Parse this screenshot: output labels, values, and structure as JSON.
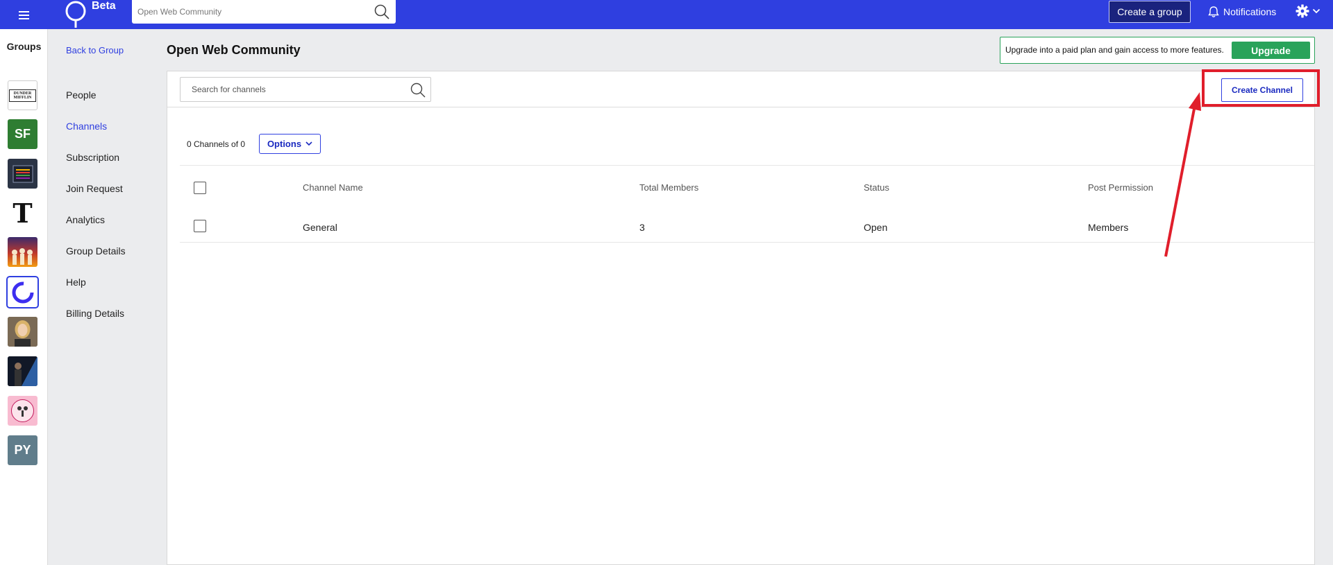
{
  "topbar": {
    "logo_badge": "Beta",
    "search_placeholder": "Open Web Community",
    "create_group_label": "Create a group",
    "notifications_label": "Notifications",
    "brand_color": "#2f3fe0"
  },
  "rail": {
    "title": "Groups",
    "groups": [
      {
        "label": "DUNDER MIFFLIN",
        "kind": "logo"
      },
      {
        "label": "SF",
        "color": "#2e7d32"
      },
      {
        "label": "",
        "kind": "book"
      },
      {
        "label": "T",
        "kind": "nyt"
      },
      {
        "label": "",
        "kind": "concert"
      },
      {
        "label": "",
        "kind": "ring",
        "selected": true
      },
      {
        "label": "",
        "kind": "person"
      },
      {
        "label": "",
        "kind": "photo"
      },
      {
        "label": "",
        "kind": "pink-badge"
      },
      {
        "label": "PY",
        "color": "#607d8b"
      }
    ]
  },
  "subnav": {
    "back": "Back to Group",
    "items": [
      "People",
      "Channels",
      "Subscription",
      "Join Request",
      "Analytics",
      "Group Details",
      "Help",
      "Billing Details"
    ],
    "active": "Channels"
  },
  "main": {
    "title": "Open Web Community",
    "upgrade_text": "Upgrade into a paid plan and gain access to more features.",
    "upgrade_button": "Upgrade",
    "search_placeholder": "Search for channels",
    "create_channel": "Create Channel",
    "count": "0 Channels of 0",
    "options": "Options",
    "columns": [
      "Channel Name",
      "Total Members",
      "Status",
      "Post Permission"
    ],
    "rows": [
      {
        "name": "General",
        "members": "3",
        "status": "Open",
        "permission": "Members"
      }
    ]
  },
  "annotation": {
    "color": "#e01e2b"
  }
}
